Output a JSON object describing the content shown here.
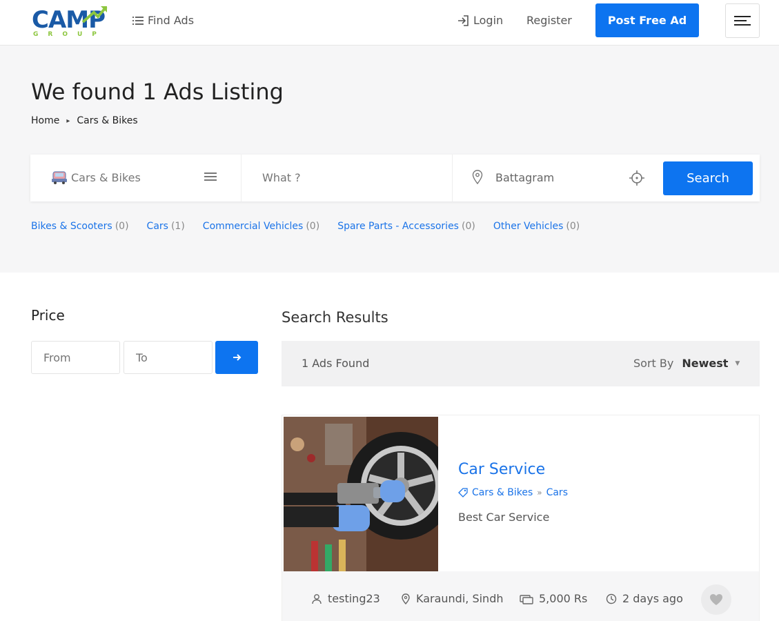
{
  "header": {
    "logo_main": "CAMP",
    "logo_sub": "GROUP",
    "find_ads": "Find Ads",
    "login": "Login",
    "register": "Register",
    "post_ad": "Post Free Ad"
  },
  "hero": {
    "title": "We found 1 Ads Listing",
    "breadcrumb": [
      "Home",
      "Cars & Bikes"
    ]
  },
  "search": {
    "category": "Cars & Bikes",
    "what_placeholder": "What ?",
    "location": "Battagram",
    "button": "Search"
  },
  "categories": [
    {
      "label": "Bikes & Scooters",
      "count": "(0)"
    },
    {
      "label": "Cars",
      "count": "(1)"
    },
    {
      "label": "Commercial Vehicles",
      "count": "(0)"
    },
    {
      "label": "Spare Parts - Accessories",
      "count": "(0)"
    },
    {
      "label": "Other Vehicles",
      "count": "(0)"
    }
  ],
  "filter": {
    "price_title": "Price",
    "from_placeholder": "From",
    "to_placeholder": "To"
  },
  "results": {
    "title": "Search Results",
    "count": "1 Ads Found",
    "sort_label": "Sort By",
    "sort_value": "Newest"
  },
  "ad": {
    "title": "Car Service",
    "category": "Cars & Bikes",
    "subcategory": "Cars",
    "description": "Best Car Service",
    "user": "testing23",
    "location": "Karaundi, Sindh",
    "price": "5,000 Rs",
    "posted": "2 days ago"
  },
  "colors": {
    "primary": "#0d74f0",
    "link": "#1a73e8",
    "logo_blue": "#1a5aa6",
    "logo_green": "#8dc63f",
    "band_bg": "#f6f6f7"
  }
}
